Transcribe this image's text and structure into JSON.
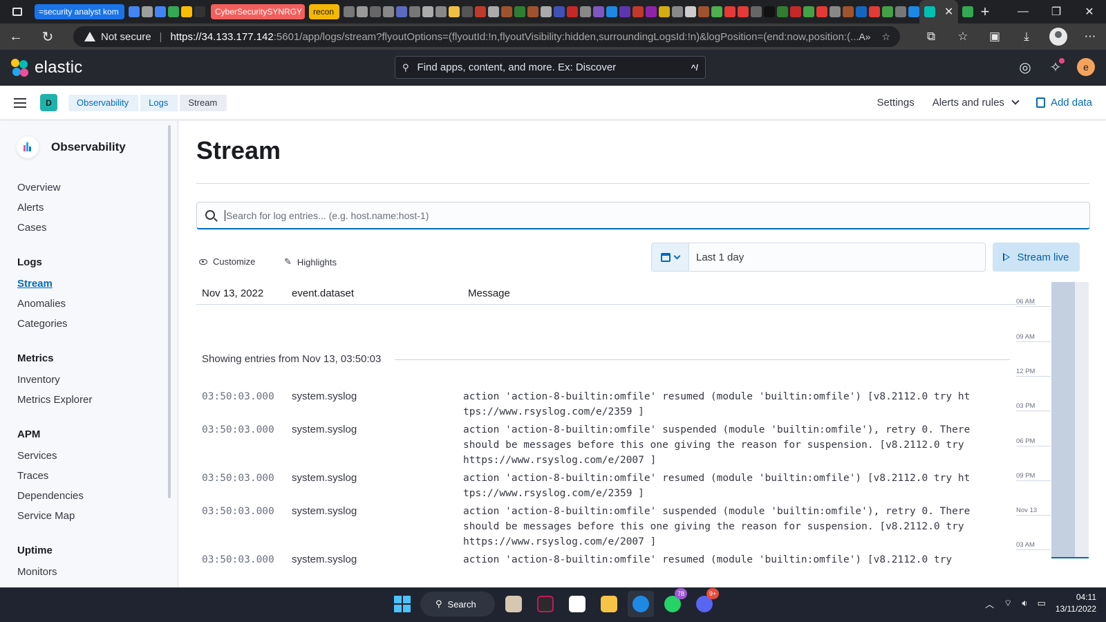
{
  "browser": {
    "tabs": [
      {
        "label": "=security analyst kom",
        "color": "#1a73e8"
      },
      {
        "label": "CyberSecuritySYNRGY",
        "color": "#f25f5c"
      },
      {
        "label": "recon",
        "color": "#f5b800"
      }
    ],
    "address": {
      "security_label": "Not secure",
      "url_host": "https://34.133.177.142",
      "url_rest": ":5601/app/logs/stream?flyoutOptions=(flyoutId:!n,flyoutVisibility:hidden,surroundingLogsId:!n)&logPosition=(end:now,position:(..."
    }
  },
  "kibana": {
    "brand": "elastic",
    "search_placeholder": "Find apps, content, and more. Ex: Discover",
    "search_shortcut": "^/",
    "user_initial": "e",
    "space_initial": "D",
    "breadcrumbs": [
      "Observability",
      "Logs",
      "Stream"
    ],
    "header_links": {
      "settings": "Settings",
      "alerts": "Alerts and rules",
      "add_data": "Add data"
    }
  },
  "sidenav": {
    "title": "Observability",
    "top_items": [
      "Overview",
      "Alerts",
      "Cases"
    ],
    "groups": [
      {
        "name": "Logs",
        "items": [
          "Stream",
          "Anomalies",
          "Categories"
        ]
      },
      {
        "name": "Metrics",
        "items": [
          "Inventory",
          "Metrics Explorer"
        ]
      },
      {
        "name": "APM",
        "items": [
          "Services",
          "Traces",
          "Dependencies",
          "Service Map"
        ]
      },
      {
        "name": "Uptime",
        "items": [
          "Monitors"
        ]
      }
    ],
    "active_item": "Stream"
  },
  "main": {
    "title": "Stream",
    "search_placeholder": "Search for log entries... (e.g. host.name:host-1)",
    "customize": "Customize",
    "highlights": "Highlights",
    "time_range": "Last 1 day",
    "stream_live": "Stream live",
    "columns": {
      "date": "Nov 13, 2022",
      "dataset": "event.dataset",
      "message": "Message"
    },
    "showing": "Showing entries from Nov 13, 03:50:03",
    "rows": [
      {
        "ts": "03:50:03.000",
        "dataset": "system.syslog",
        "message": "action 'action-8-builtin:omfile' resumed (module 'builtin:omfile') [v8.2112.0 try https://www.rsyslog.com/e/2359 ]"
      },
      {
        "ts": "03:50:03.000",
        "dataset": "system.syslog",
        "message": "action 'action-8-builtin:omfile' suspended (module 'builtin:omfile'), retry 0. There should be messages before this one giving the reason for suspension. [v8.2112.0 try https://www.rsyslog.com/e/2007 ]"
      },
      {
        "ts": "03:50:03.000",
        "dataset": "system.syslog",
        "message": "action 'action-8-builtin:omfile' resumed (module 'builtin:omfile') [v8.2112.0 try https://www.rsyslog.com/e/2359 ]"
      },
      {
        "ts": "03:50:03.000",
        "dataset": "system.syslog",
        "message": "action 'action-8-builtin:omfile' suspended (module 'builtin:omfile'), retry 0. There should be messages before this one giving the reason for suspension. [v8.2112.0 try https://www.rsyslog.com/e/2007 ]"
      },
      {
        "ts": "03:50:03.000",
        "dataset": "system.syslog",
        "message": "action 'action-8-builtin:omfile' resumed (module 'builtin:omfile') [v8.2112.0 try"
      }
    ],
    "minimap_labels": [
      "06 AM",
      "09 AM",
      "12 PM",
      "03 PM",
      "06 PM",
      "09 PM",
      "Nov 13",
      "03 AM"
    ]
  },
  "taskbar": {
    "search_label": "Search",
    "whatsapp_badge": "78",
    "discord_badge": "9+",
    "time": "04:11",
    "date": "13/11/2022"
  }
}
